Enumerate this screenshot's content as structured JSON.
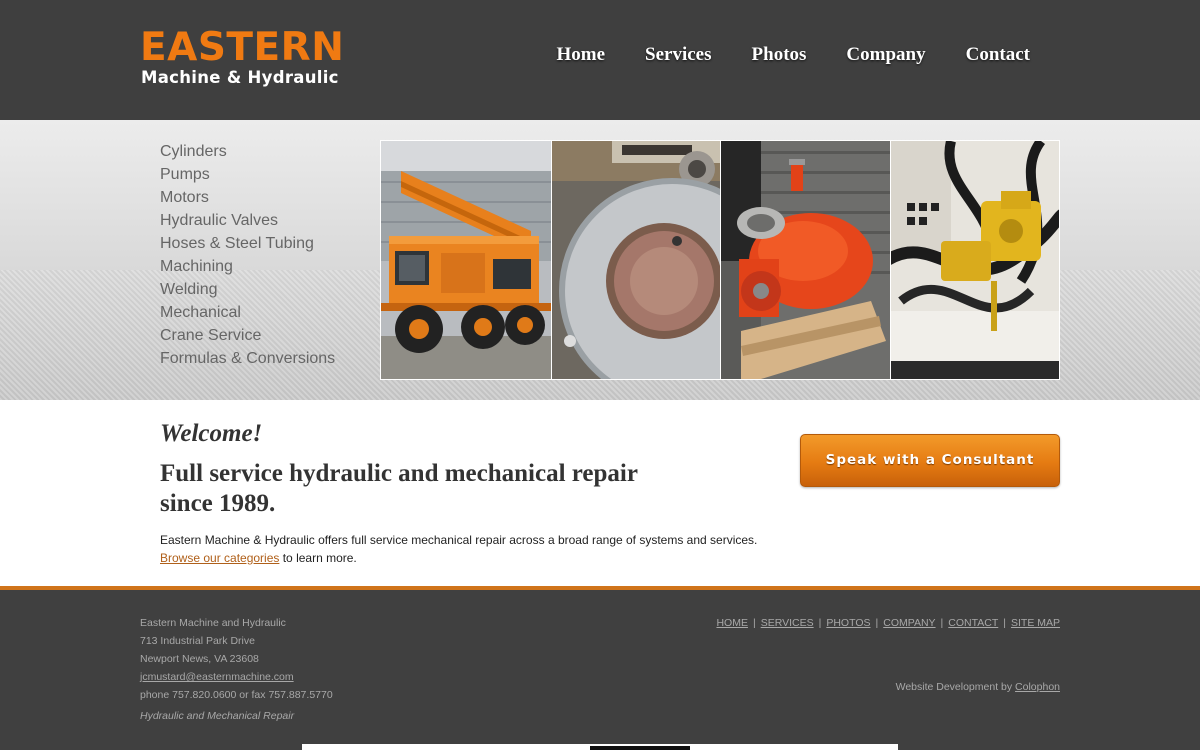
{
  "logo": {
    "main": "EASTERN",
    "sub": "Machine & Hydraulic"
  },
  "nav": [
    "Home",
    "Services",
    "Photos",
    "Company",
    "Contact"
  ],
  "categories": [
    "Cylinders",
    "Pumps",
    "Motors",
    "Hydraulic Valves",
    "Hoses & Steel Tubing",
    "Machining",
    "Welding",
    "Mechanical",
    "Crane Service",
    "Formulas & Conversions"
  ],
  "photos": [
    "orange mobile crane",
    "machined steel ring",
    "red hydraulic motor on pallet",
    "hydraulic hoses and yellow pump"
  ],
  "main": {
    "welcome": "Welcome!",
    "tagline": "Full service hydraulic and mechanical repair since 1989.",
    "description": "Eastern Machine & Hydraulic offers full service mechanical repair across a broad range of systems and services.",
    "browse_link": "Browse our categories",
    "browse_suffix": " to learn more.",
    "cta": "Speak with a Consultant"
  },
  "footer": {
    "company": "Eastern Machine and Hydraulic",
    "street": "713 Industrial Park Drive",
    "city": "Newport News, VA 23608",
    "email": "jcmustard@easternmachine.com",
    "phone": "phone 757.820.0600 or fax 757.887.5770",
    "slogan": "Hydraulic and Mechanical Repair",
    "links": [
      "HOME",
      "SERVICES",
      "PHOTOS",
      "COMPANY",
      "CONTACT",
      "SITE MAP"
    ],
    "credit_prefix": "Website Development by ",
    "credit_link": "Colophon"
  },
  "colors": {
    "accent": "#f07a12",
    "header_bg": "#3f3f3f",
    "footer_bg": "#404040",
    "link": "#b0601a"
  }
}
